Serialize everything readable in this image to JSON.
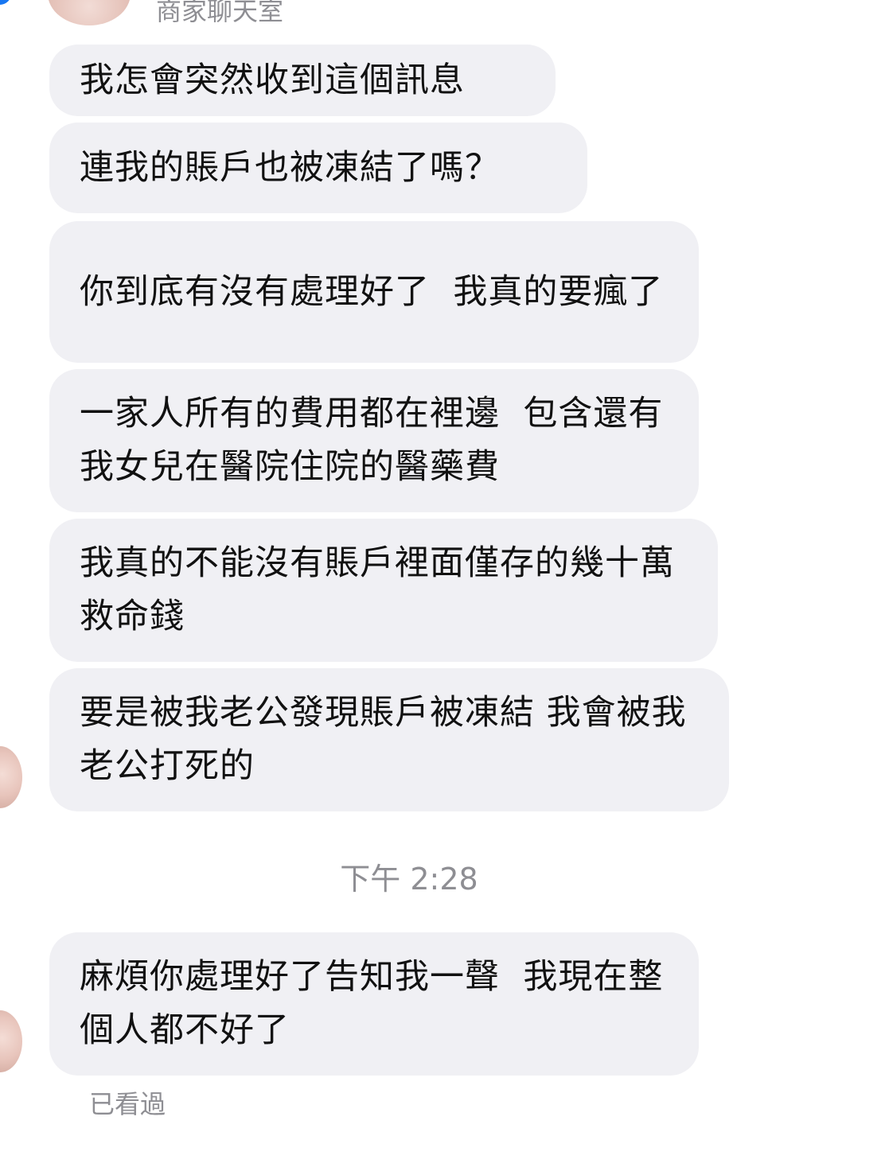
{
  "header": {
    "title": "商家聊天室",
    "avatar_icon": "profile-photo",
    "status_color": "#1877f2"
  },
  "messages": [
    {
      "text": "我怎會突然收到這個訊息"
    },
    {
      "text": "連我的賬戶也被凍結了嗎？"
    },
    {
      "text": "你到底有沒有處理好了  我真的要瘋了"
    },
    {
      "text": "一家人所有的費用都在裡邊  包含還有我女兒在醫院住院的醫藥費"
    },
    {
      "text": "我真的不能沒有賬戶裡面僅存的幾十萬救命錢"
    },
    {
      "text": "要是被我老公發現賬戶被凍結 我會被我老公打死的"
    },
    {
      "text": "麻煩你處理好了告知我一聲  我現在整個人都不好了"
    }
  ],
  "timestamp": "下午 2:28",
  "read_receipt": "已看過",
  "colors": {
    "bubble_bg": "#f0f0f4",
    "text": "#111111",
    "meta_text": "#8e8e93"
  }
}
